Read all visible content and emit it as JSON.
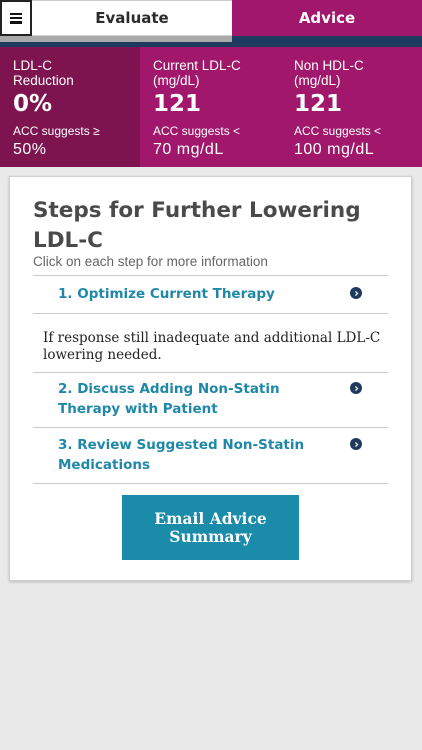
{
  "tabs": {
    "evaluate_label": "Evaluate",
    "advice_label": "Advice"
  },
  "metrics": [
    {
      "label": "LDL-C Reduction",
      "value": "0%",
      "suggest": "ACC suggests ≥",
      "target": "50%"
    },
    {
      "label": "Current LDL-C (mg/dL)",
      "value": "121",
      "suggest": "ACC suggests <",
      "target": "70  mg/dL"
    },
    {
      "label": "Non HDL-C (mg/dL)",
      "value": "121",
      "suggest": "ACC suggests <",
      "target": "100  mg/dL"
    }
  ],
  "card": {
    "title": "Steps for Further Lowering LDL-C",
    "subtitle": "Click on each step for more information",
    "steps": [
      {
        "label": "1. Optimize Current Therapy"
      },
      {
        "label": "2. Discuss Adding Non-Statin Therapy with Patient"
      },
      {
        "label": "3. Review Suggested Non-Statin Medications"
      }
    ],
    "note": "If response still inadequate and additional LDL-C lowering needed.",
    "email_button": "Email Advice Summary"
  },
  "colors": {
    "brand_magenta": "#a0176c",
    "dark_magenta": "#7d1450",
    "navy": "#1f3a5f",
    "teal": "#1a8caa"
  },
  "icons": {
    "menu": "hamburger-icon",
    "step_arrow": "circle-chevron-right-icon"
  }
}
